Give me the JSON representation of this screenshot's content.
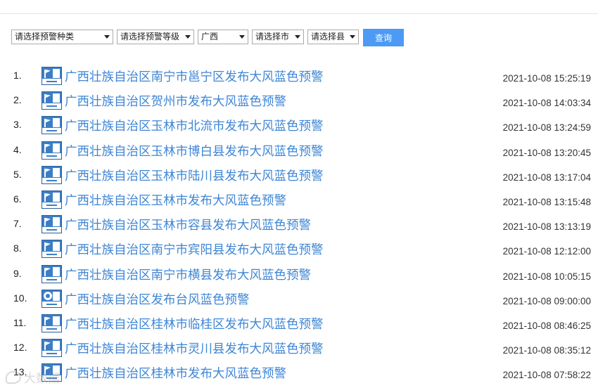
{
  "filters": {
    "warning_type": "请选择预警种类",
    "warning_level": "请选择预警等级",
    "province": "广西",
    "city": "请选择市",
    "county": "请选择县",
    "query_label": "查询"
  },
  "warnings": [
    {
      "num": "1.",
      "icon": "gale-blue-warning-icon",
      "title": "广西壮族自治区南宁市邕宁区发布大风蓝色预警",
      "time": "2021-10-08 15:25:19"
    },
    {
      "num": "2.",
      "icon": "gale-blue-warning-icon",
      "title": "广西壮族自治区贺州市发布大风蓝色预警",
      "time": "2021-10-08 14:03:34"
    },
    {
      "num": "3.",
      "icon": "gale-blue-warning-icon",
      "title": "广西壮族自治区玉林市北流市发布大风蓝色预警",
      "time": "2021-10-08 13:24:59"
    },
    {
      "num": "4.",
      "icon": "gale-blue-warning-icon",
      "title": "广西壮族自治区玉林市博白县发布大风蓝色预警",
      "time": "2021-10-08 13:20:45"
    },
    {
      "num": "5.",
      "icon": "gale-blue-warning-icon",
      "title": "广西壮族自治区玉林市陆川县发布大风蓝色预警",
      "time": "2021-10-08 13:17:04"
    },
    {
      "num": "6.",
      "icon": "gale-blue-warning-icon",
      "title": "广西壮族自治区玉林市发布大风蓝色预警",
      "time": "2021-10-08 13:15:48"
    },
    {
      "num": "7.",
      "icon": "gale-blue-warning-icon",
      "title": "广西壮族自治区玉林市容县发布大风蓝色预警",
      "time": "2021-10-08 13:13:19"
    },
    {
      "num": "8.",
      "icon": "gale-blue-warning-icon",
      "title": "广西壮族自治区南宁市宾阳县发布大风蓝色预警",
      "time": "2021-10-08 12:12:00"
    },
    {
      "num": "9.",
      "icon": "gale-blue-warning-icon",
      "title": "广西壮族自治区南宁市横县发布大风蓝色预警",
      "time": "2021-10-08 10:05:15"
    },
    {
      "num": "10.",
      "icon": "typhoon-blue-warning-icon",
      "title": "广西壮族自治区发布台风蓝色预警",
      "time": "2021-10-08 09:00:00"
    },
    {
      "num": "11.",
      "icon": "gale-blue-warning-icon",
      "title": "广西壮族自治区桂林市临桂区发布大风蓝色预警",
      "time": "2021-10-08 08:46:25"
    },
    {
      "num": "12.",
      "icon": "gale-blue-warning-icon",
      "title": "广西壮族自治区桂林市灵川县发布大风蓝色预警",
      "time": "2021-10-08 08:35:12"
    },
    {
      "num": "13.",
      "icon": "gale-blue-warning-icon",
      "title": "广西壮族自治区桂林市发布大风蓝色预警",
      "time": "2021-10-08 07:58:22"
    }
  ],
  "watermark": {
    "text": "大数据"
  },
  "colors": {
    "link": "#3e86d5",
    "button": "#4c9af5",
    "icon_bg": "#3c7ec6"
  }
}
